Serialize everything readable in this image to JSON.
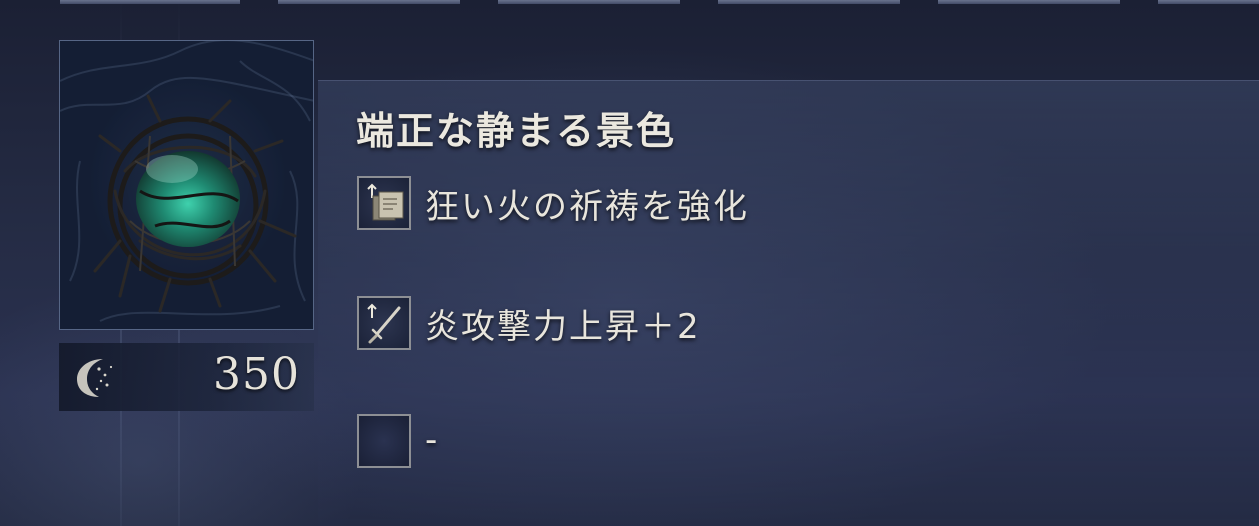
{
  "item": {
    "name": "端正な静まる景色",
    "price": "350",
    "image_icon": "bird-nest-relic-icon",
    "currency_icon": "rune-icon"
  },
  "effects": [
    {
      "icon": "incantation-scroll-icon",
      "text": "狂い火の祈祷を強化"
    },
    {
      "icon": "sword-icon",
      "text": "炎攻撃力上昇＋2"
    },
    {
      "icon": "empty-slot-icon",
      "text": "-"
    }
  ],
  "colors": {
    "background": "#232a42",
    "text": "#e8e5dc",
    "slot_border": "#8d8f94",
    "frame_border": "#8ca0c8",
    "gem": "#2fa58a"
  }
}
